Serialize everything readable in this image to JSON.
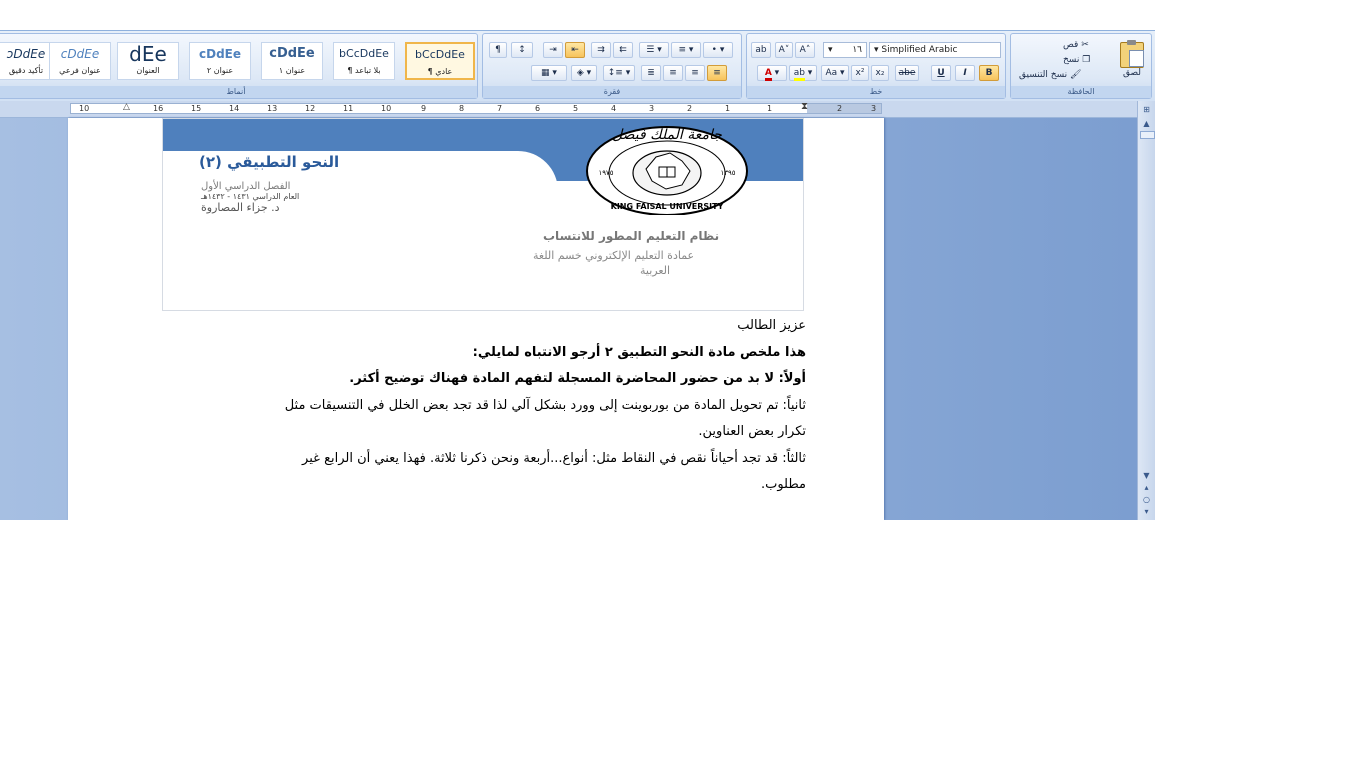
{
  "ribbon": {
    "styles_group": {
      "label": "أنماط",
      "items": [
        {
          "sample": "ɔDdEe",
          "name": "تأكيد دقيق"
        },
        {
          "sample": "cDdEe",
          "name": "عنوان فرعي"
        },
        {
          "sample": "dEe",
          "name": "العنوان"
        },
        {
          "sample": "cDdEe",
          "name": "عنوان ٢"
        },
        {
          "sample": "cDdEe",
          "name": "عنوان ١"
        },
        {
          "sample": "bCcDdEe",
          "name": "¶ بلا تباعد"
        },
        {
          "sample": "bCcDdEe",
          "name": "¶ عادي"
        }
      ]
    },
    "paragraph_group": {
      "label": "فقرة"
    },
    "font_group": {
      "label": "خط",
      "font_size": "١٦",
      "font_name": "Simplified Arabic"
    },
    "clipboard_group": {
      "label": "الحافظة",
      "cut": "قص",
      "copy": "نسخ",
      "format_painter": "نسخ التنسيق",
      "paste": "لصق"
    },
    "colors": {
      "highlight": "#f7c35c",
      "font_color": "#d00000",
      "highlight_color": "#ffff00"
    }
  },
  "ruler": {
    "numbers": [
      "10",
      "16",
      "15",
      "14",
      "13",
      "12",
      "11",
      "10",
      "9",
      "8",
      "7",
      "6",
      "5",
      "4",
      "3",
      "2",
      "1",
      "1",
      "2",
      "3"
    ]
  },
  "document": {
    "header": {
      "course_title": "النحو التطبيقي (٢)",
      "semester": "الفصل الدراسي الأول",
      "year": "العام الدراسي ١٤٣١ - ١٤٣٢هـ",
      "doctor": "د. جزاء المصاروة",
      "system_title": "نظام التعليم المطور للانتساب",
      "system_sub1": "عمادة التعليم الإلكتروني خسم اللغة",
      "system_sub2": "العربية",
      "university_name_en": "KING FAISAL UNIVERSITY",
      "university_name_ar": "جامعة الملك فيصل",
      "year_left": "١٩٧٥",
      "year_right": "١٣٩٥"
    },
    "lines": [
      "عزيز الطالب",
      "هذا ملخص مادة النحو التطبيق ٢ أرجو الانتباه لمايلي:",
      "أولاً: لا بد من حضور المحاضرة المسجلة لتفهم المادة فهناك توضيح أكثر.",
      "ثانياً: تم تحويل المادة من بوربوينت إلى وورد بشكل آلي لذا قد تجد بعض الخلل في التنسيقات مثل",
      "تكرار بعض العناوين.",
      "ثالثاً: قد تجد أحياناً نقص في النقاط مثل: أنواع...أربعة ونحن ذكرنا ثلاثة. فهذا يعني أن الرابع غير",
      "مطلوب."
    ]
  }
}
